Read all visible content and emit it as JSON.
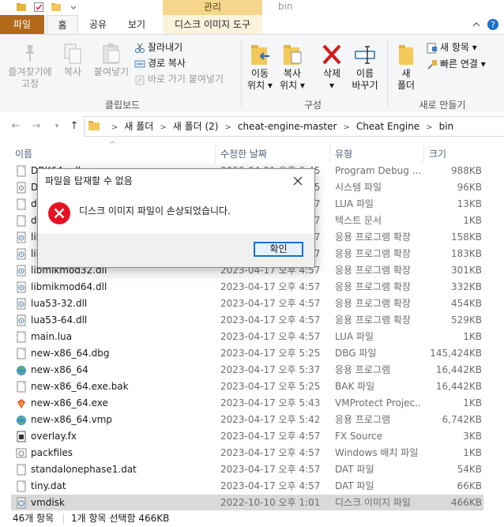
{
  "window": {
    "title": "bin",
    "contextual_header": "관리"
  },
  "tabs": [
    {
      "label": "파일"
    },
    {
      "label": "홈"
    },
    {
      "label": "공유"
    },
    {
      "label": "보기"
    },
    {
      "label": "디스크 이미지 도구"
    }
  ],
  "ribbon": {
    "pin_line1": "즐겨찾기에",
    "pin_line2": "고정",
    "copy": "복사",
    "paste": "붙여넣기",
    "cut": "잘라내기",
    "copy_path": "경로 복사",
    "paste_shortcut": "바로 가기 붙여넣기",
    "clipboard_group": "클립보드",
    "move_line1": "이동",
    "move_line2": "위치 ▾",
    "copyto_line1": "복사",
    "copyto_line2": "위치 ▾",
    "delete_line1": "삭제",
    "delete_line2": "▾",
    "rename_line1": "이름",
    "rename_line2": "바꾸기",
    "organize_group": "구성",
    "newfolder_line1": "새",
    "newfolder_line2": "폴더",
    "new_item": "새 항목 ▾",
    "easy_access": "빠른 연결 ▾",
    "new_group": "새로 만들기"
  },
  "address": {
    "crumbs": [
      "새 폴더",
      "새 폴더 (2)",
      "cheat-engine-master",
      "Cheat Engine",
      "bin"
    ]
  },
  "columns": {
    "name": "이름",
    "date": "수정한 날짜",
    "type": "유형",
    "size": "크기"
  },
  "files": [
    {
      "name": "DBK64.pdb",
      "date": "2023-04-21 오후 6:45",
      "type": "Program Debug ...",
      "size": "988KB",
      "icon": "file-icon"
    },
    {
      "name": "D",
      "date": "2023-04-17 오후 4:55",
      "type": "시스템 파일",
      "size": "96KB",
      "icon": "settings-file-icon"
    },
    {
      "name": "d",
      "date": "2023-04-17 오후 4:57",
      "type": "LUA 파일",
      "size": "13KB",
      "icon": "file-icon"
    },
    {
      "name": "d",
      "date": "2023-04-17 오후 4:57",
      "type": "텍스트 문서",
      "size": "1KB",
      "icon": "file-icon"
    },
    {
      "name": "lib",
      "date": "2023-04-17 오후 4:57",
      "type": "응용 프로그램 확장",
      "size": "158KB",
      "icon": "dll-icon"
    },
    {
      "name": "lib",
      "date": "2023-04-17 오후 4:57",
      "type": "응용 프로그램 확장",
      "size": "183KB",
      "icon": "dll-icon"
    },
    {
      "name": "libmikmod32.dll",
      "date": "2023-04-17 오후 4:57",
      "type": "응용 프로그램 확장",
      "size": "301KB",
      "icon": "dll-icon"
    },
    {
      "name": "libmikmod64.dll",
      "date": "2023-04-17 오후 4:57",
      "type": "응용 프로그램 확장",
      "size": "332KB",
      "icon": "dll-icon"
    },
    {
      "name": "lua53-32.dll",
      "date": "2023-04-17 오후 4:57",
      "type": "응용 프로그램 확장",
      "size": "454KB",
      "icon": "dll-icon"
    },
    {
      "name": "lua53-64.dll",
      "date": "2023-04-17 오후 4:57",
      "type": "응용 프로그램 확장",
      "size": "529KB",
      "icon": "dll-icon"
    },
    {
      "name": "main.lua",
      "date": "2023-04-17 오후 4:57",
      "type": "LUA 파일",
      "size": "1KB",
      "icon": "file-icon"
    },
    {
      "name": "new-x86_64.dbg",
      "date": "2023-04-17 오후 5:25",
      "type": "DBG 파일",
      "size": "145,424KB",
      "icon": "file-icon"
    },
    {
      "name": "new-x86_64",
      "date": "2023-04-17 오후 5:37",
      "type": "응용 프로그램",
      "size": "16,442KB",
      "icon": "globe-app-icon"
    },
    {
      "name": "new-x86_64.exe.bak",
      "date": "2023-04-17 오후 5:25",
      "type": "BAK 파일",
      "size": "16,442KB",
      "icon": "file-icon"
    },
    {
      "name": "new-x86_64.exe",
      "date": "2023-04-17 오후 5:43",
      "type": "VMProtect Projec...",
      "size": "1KB",
      "icon": "vmprotect-icon"
    },
    {
      "name": "new-x86_64.vmp",
      "date": "2023-04-17 오후 5:42",
      "type": "응용 프로그램",
      "size": "6,742KB",
      "icon": "globe-app-icon"
    },
    {
      "name": "overlay.fx",
      "date": "2023-04-17 오후 4:57",
      "type": "FX Source",
      "size": "3KB",
      "icon": "fx-file-icon"
    },
    {
      "name": "packfiles",
      "date": "2023-04-17 오후 4:57",
      "type": "Windows 배치 파일",
      "size": "1KB",
      "icon": "batch-file-icon"
    },
    {
      "name": "standalonephase1.dat",
      "date": "2023-04-17 오후 4:57",
      "type": "DAT 파일",
      "size": "54KB",
      "icon": "file-icon"
    },
    {
      "name": "tiny.dat",
      "date": "2023-04-17 오후 4:57",
      "type": "DAT 파일",
      "size": "66KB",
      "icon": "file-icon"
    },
    {
      "name": "vmdisk",
      "date": "2022-10-10 오후 1:01",
      "type": "디스크 이미지 파일",
      "size": "466KB",
      "icon": "disk-image-icon",
      "selected": true
    }
  ],
  "status": {
    "count": "46개 항목",
    "selected": "1개 항목 선택함 466KB"
  },
  "dialog": {
    "title": "파일을 탑재할 수 없음",
    "message": "디스크 이미지 파일이 손상되었습니다.",
    "ok": "확인"
  },
  "colors": {
    "file_tab": "#b2691a",
    "contextual": "#f6d68a",
    "selection": "#d9d9d9",
    "accent": "#1a6fcf",
    "error": "#e81123"
  }
}
